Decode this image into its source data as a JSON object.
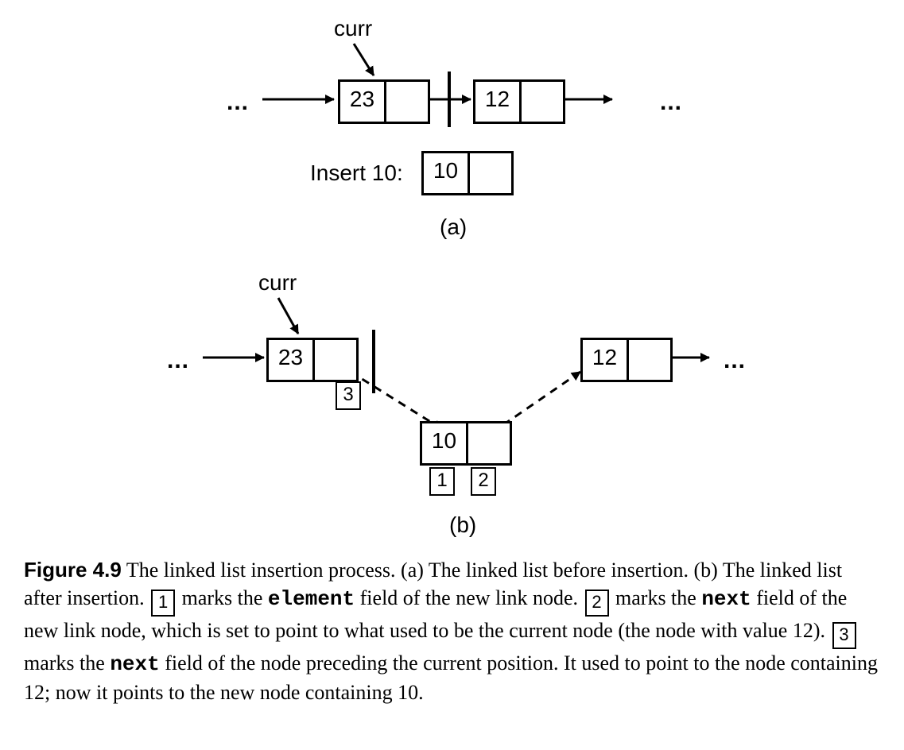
{
  "figure": {
    "number": "Figure 4.9",
    "summary": "The linked list insertion process.",
    "part_a_text": "(a) The linked list before insertion.",
    "part_b_text": "(b) The linked list after insertion.",
    "step1_text_a": "marks the",
    "step1_field": "element",
    "step1_text_b": "field of the new link node.",
    "step2_text_a": "marks the",
    "step2_field": "next",
    "step2_text_b": "field of the new link node, which is set to point to what used to be the current node (the node with value 12).",
    "step3_text_a": "marks the",
    "step3_field": "next",
    "step3_text_b": "field of the node preceding the current position. It used to point to the node containing 12; now it points to the new node containing 10."
  },
  "labels": {
    "curr": "curr",
    "insert_prefix": "Insert 10:",
    "part_a": "(a)",
    "part_b": "(b)",
    "ellipsis": "..."
  },
  "steps": {
    "s1": "1",
    "s2": "2",
    "s3": "3"
  },
  "nodes": {
    "n23": "23",
    "n12": "12",
    "n10": "10"
  }
}
